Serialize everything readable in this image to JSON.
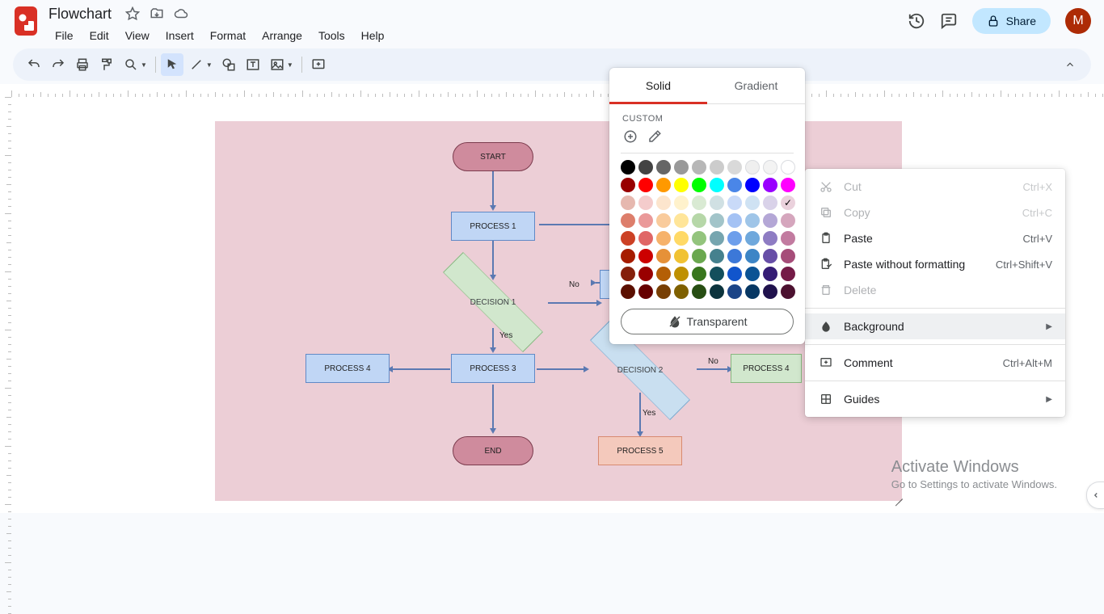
{
  "doc": {
    "title": "Flowchart"
  },
  "menus": [
    "File",
    "Edit",
    "View",
    "Insert",
    "Format",
    "Arrange",
    "Tools",
    "Help"
  ],
  "share": {
    "label": "Share"
  },
  "avatar": {
    "initial": "M"
  },
  "colorpicker": {
    "tabs": {
      "solid": "Solid",
      "gradient": "Gradient"
    },
    "custom_label": "CUSTOM",
    "transparent_label": "Transparent"
  },
  "context_menu": {
    "cut": {
      "label": "Cut",
      "shortcut": "Ctrl+X"
    },
    "copy": {
      "label": "Copy",
      "shortcut": "Ctrl+C"
    },
    "paste": {
      "label": "Paste",
      "shortcut": "Ctrl+V"
    },
    "paste_no_fmt": {
      "label": "Paste without formatting",
      "shortcut": "Ctrl+Shift+V"
    },
    "delete": {
      "label": "Delete"
    },
    "background": {
      "label": "Background"
    },
    "comment": {
      "label": "Comment",
      "shortcut": "Ctrl+Alt+M"
    },
    "guides": {
      "label": "Guides"
    }
  },
  "flowchart": {
    "start": "START",
    "process1": "PROCESS 1",
    "decision1": "DECISION 1",
    "process3": "PROCESS 3",
    "process4_left": "PROCESS 4",
    "decision2": "DECISION 2",
    "process4_right": "PROCESS 4",
    "process5": "PROCESS 5",
    "end": "END",
    "no": "No",
    "yes": "Yes"
  },
  "watermark": {
    "line1": "Activate Windows",
    "line2": "Go to Settings to activate Windows."
  },
  "swatches": {
    "row0": [
      "#000000",
      "#434343",
      "#666666",
      "#999999",
      "#b7b7b7",
      "#cccccc",
      "#d9d9d9",
      "#efefef",
      "#f3f3f3",
      "#ffffff"
    ],
    "row1": [
      "#980000",
      "#ff0000",
      "#ff9900",
      "#ffff00",
      "#00ff00",
      "#00ffff",
      "#4a86e8",
      "#0000ff",
      "#9900ff",
      "#ff00ff"
    ],
    "row2": [
      "#e6b8af",
      "#f4cccc",
      "#fce5cd",
      "#fff2cc",
      "#d9ead3",
      "#d0e0e3",
      "#c9daf8",
      "#cfe2f3",
      "#d9d2e9",
      "#ead1dc"
    ],
    "row3": [
      "#dd7e6b",
      "#ea9999",
      "#f9cb9c",
      "#ffe599",
      "#b6d7a8",
      "#a2c4c9",
      "#a4c2f4",
      "#9fc5e8",
      "#b4a7d6",
      "#d5a6bd"
    ],
    "row4": [
      "#cc4125",
      "#e06666",
      "#f6b26b",
      "#ffd966",
      "#93c47d",
      "#76a5af",
      "#6d9eeb",
      "#6fa8dc",
      "#8e7cc3",
      "#c27ba0"
    ],
    "row5": [
      "#a61c00",
      "#cc0000",
      "#e69138",
      "#f1c232",
      "#6aa84f",
      "#45818e",
      "#3c78d8",
      "#3d85c6",
      "#674ea7",
      "#a64d79"
    ],
    "row6": [
      "#85200c",
      "#990000",
      "#b45f06",
      "#bf9000",
      "#38761d",
      "#134f5c",
      "#1155cc",
      "#0b5394",
      "#351c75",
      "#741b47"
    ],
    "row7": [
      "#5b0f00",
      "#660000",
      "#783f04",
      "#7f6000",
      "#274e13",
      "#0c343d",
      "#1c4587",
      "#073763",
      "#20124d",
      "#4c1130"
    ]
  },
  "selected_swatch": "#ead1dc"
}
